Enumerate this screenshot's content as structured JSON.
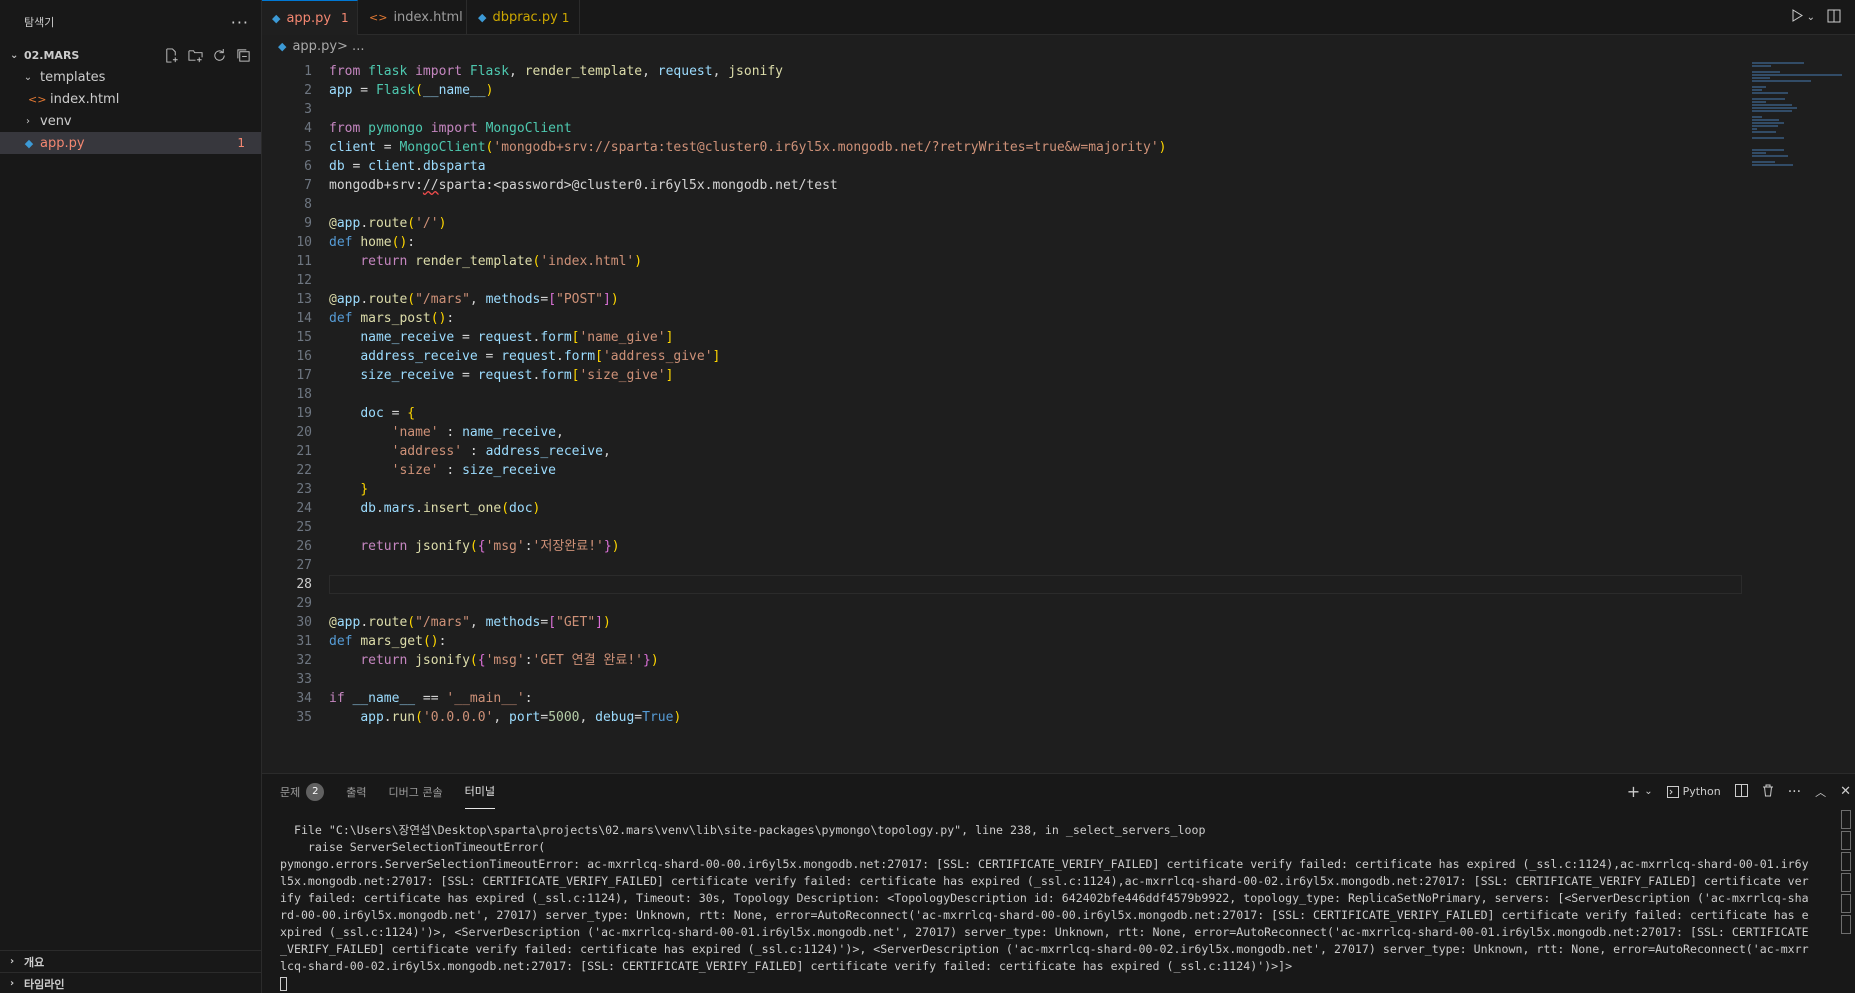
{
  "explorer": {
    "title": "탐색기",
    "more": "···",
    "root": "02.MARS",
    "items": [
      {
        "label": "templates",
        "chev": "⌄"
      },
      {
        "label": "index.html",
        "icon": "<>"
      },
      {
        "label": "venv",
        "chev": "›"
      },
      {
        "label": "app.py",
        "count": "1"
      }
    ],
    "outline": "개요",
    "timeline": "타임라인"
  },
  "tabs": [
    {
      "label": "app.py",
      "count": "1"
    },
    {
      "label": "index.html"
    },
    {
      "label": "dbprac.py",
      "count": "1"
    }
  ],
  "breadcrumb": {
    "file": "app.py",
    "rest": " > ..."
  },
  "editor": {
    "current_line": 28
  },
  "panel": {
    "tabs": [
      "문제",
      "출력",
      "디버그 콘솔",
      "터미널"
    ],
    "problems_count": "2",
    "shell": "Python",
    "terminal_text": "  File \"C:\\Users\\장연섭\\Desktop\\sparta\\projects\\02.mars\\venv\\lib\\site-packages\\pymongo\\topology.py\", line 238, in _select_servers_loop\n    raise ServerSelectionTimeoutError(\npymongo.errors.ServerSelectionTimeoutError: ac-mxrrlcq-shard-00-00.ir6yl5x.mongodb.net:27017: [SSL: CERTIFICATE_VERIFY_FAILED] certificate verify failed: certificate has expired (_ssl.c:1124),ac-mxrrlcq-shard-00-01.ir6yl5x.mongodb.net:27017: [SSL: CERTIFICATE_VERIFY_FAILED] certificate verify failed: certificate has expired (_ssl.c:1124),ac-mxrrlcq-shard-00-02.ir6yl5x.mongodb.net:27017: [SSL: CERTIFICATE_VERIFY_FAILED] certificate verify failed: certificate has expired (_ssl.c:1124), Timeout: 30s, Topology Description: <TopologyDescription id: 642402bfe446ddf4579b9922, topology_type: ReplicaSetNoPrimary, servers: [<ServerDescription ('ac-mxrrlcq-shard-00-00.ir6yl5x.mongodb.net', 27017) server_type: Unknown, rtt: None, error=AutoReconnect('ac-mxrrlcq-shard-00-00.ir6yl5x.mongodb.net:27017: [SSL: CERTIFICATE_VERIFY_FAILED] certificate verify failed: certificate has expired (_ssl.c:1124)')>, <ServerDescription ('ac-mxrrlcq-shard-00-01.ir6yl5x.mongodb.net', 27017) server_type: Unknown, rtt: None, error=AutoReconnect('ac-mxrrlcq-shard-00-01.ir6yl5x.mongodb.net:27017: [SSL: CERTIFICATE_VERIFY_FAILED] certificate verify failed: certificate has expired (_ssl.c:1124)')>, <ServerDescription ('ac-mxrrlcq-shard-00-02.ir6yl5x.mongodb.net', 27017) server_type: Unknown, rtt: None, error=AutoReconnect('ac-mxrrlcq-shard-00-02.ir6yl5x.mongodb.net:27017: [SSL: CERTIFICATE_VERIFY_FAILED] certificate verify failed: certificate has expired (_ssl.c:1124)')>]>"
  },
  "code": [
    [
      [
        "kw2",
        "from"
      ],
      [
        "plain",
        " "
      ],
      [
        "cls",
        "flask"
      ],
      [
        "plain",
        " "
      ],
      [
        "kw2",
        "import"
      ],
      [
        "plain",
        " "
      ],
      [
        "cls",
        "Flask"
      ],
      [
        "plain",
        ", "
      ],
      [
        "fn",
        "render_template"
      ],
      [
        "plain",
        ", "
      ],
      [
        "var",
        "request"
      ],
      [
        "plain",
        ", "
      ],
      [
        "fn",
        "jsonify"
      ]
    ],
    [
      [
        "var",
        "app"
      ],
      [
        "plain",
        " = "
      ],
      [
        "cls",
        "Flask"
      ],
      [
        "br1",
        "("
      ],
      [
        "var",
        "__name__"
      ],
      [
        "br1",
        ")"
      ]
    ],
    [],
    [
      [
        "kw2",
        "from"
      ],
      [
        "plain",
        " "
      ],
      [
        "cls",
        "pymongo"
      ],
      [
        "plain",
        " "
      ],
      [
        "kw2",
        "import"
      ],
      [
        "plain",
        " "
      ],
      [
        "cls",
        "MongoClient"
      ]
    ],
    [
      [
        "var",
        "client"
      ],
      [
        "plain",
        " = "
      ],
      [
        "cls",
        "MongoClient"
      ],
      [
        "br1",
        "("
      ],
      [
        "str",
        "'mongodb+srv://sparta:test@cluster0.ir6yl5x.mongodb.net/?retryWrites=true&w=majority'"
      ],
      [
        "br1",
        ")"
      ]
    ],
    [
      [
        "var",
        "db"
      ],
      [
        "plain",
        " = "
      ],
      [
        "var",
        "client"
      ],
      [
        "plain",
        "."
      ],
      [
        "var",
        "dbsparta"
      ]
    ],
    [
      [
        "plain",
        "mongodb+srv:"
      ],
      [
        "squig",
        "//"
      ],
      [
        "plain",
        "sparta:<password>@cluster0.ir6yl5x.mongodb.net/test"
      ]
    ],
    [],
    [
      [
        "dec",
        "@"
      ],
      [
        "var",
        "app"
      ],
      [
        "plain",
        "."
      ],
      [
        "fn",
        "route"
      ],
      [
        "br1",
        "("
      ],
      [
        "str",
        "'/'"
      ],
      [
        "br1",
        ")"
      ]
    ],
    [
      [
        "kw",
        "def"
      ],
      [
        "plain",
        " "
      ],
      [
        "fn",
        "home"
      ],
      [
        "br1",
        "()"
      ],
      [
        "plain",
        ":"
      ]
    ],
    [
      [
        "plain",
        "    "
      ],
      [
        "kw2",
        "return"
      ],
      [
        "plain",
        " "
      ],
      [
        "fn",
        "render_template"
      ],
      [
        "br1",
        "("
      ],
      [
        "str",
        "'index.html'"
      ],
      [
        "br1",
        ")"
      ]
    ],
    [],
    [
      [
        "dec",
        "@"
      ],
      [
        "var",
        "app"
      ],
      [
        "plain",
        "."
      ],
      [
        "fn",
        "route"
      ],
      [
        "br1",
        "("
      ],
      [
        "str",
        "\"/mars\""
      ],
      [
        "plain",
        ", "
      ],
      [
        "var",
        "methods"
      ],
      [
        "plain",
        "="
      ],
      [
        "br2",
        "["
      ],
      [
        "str",
        "\"POST\""
      ],
      [
        "br2",
        "]"
      ],
      [
        "br1",
        ")"
      ]
    ],
    [
      [
        "kw",
        "def"
      ],
      [
        "plain",
        " "
      ],
      [
        "fn",
        "mars_post"
      ],
      [
        "br1",
        "()"
      ],
      [
        "plain",
        ":"
      ]
    ],
    [
      [
        "plain",
        "    "
      ],
      [
        "var",
        "name_receive"
      ],
      [
        "plain",
        " = "
      ],
      [
        "var",
        "request"
      ],
      [
        "plain",
        "."
      ],
      [
        "var",
        "form"
      ],
      [
        "br1",
        "["
      ],
      [
        "str",
        "'name_give'"
      ],
      [
        "br1",
        "]"
      ]
    ],
    [
      [
        "plain",
        "    "
      ],
      [
        "var",
        "address_receive"
      ],
      [
        "plain",
        " = "
      ],
      [
        "var",
        "request"
      ],
      [
        "plain",
        "."
      ],
      [
        "var",
        "form"
      ],
      [
        "br1",
        "["
      ],
      [
        "str",
        "'address_give'"
      ],
      [
        "br1",
        "]"
      ]
    ],
    [
      [
        "plain",
        "    "
      ],
      [
        "var",
        "size_receive"
      ],
      [
        "plain",
        " = "
      ],
      [
        "var",
        "request"
      ],
      [
        "plain",
        "."
      ],
      [
        "var",
        "form"
      ],
      [
        "br1",
        "["
      ],
      [
        "str",
        "'size_give'"
      ],
      [
        "br1",
        "]"
      ]
    ],
    [],
    [
      [
        "plain",
        "    "
      ],
      [
        "var",
        "doc"
      ],
      [
        "plain",
        " = "
      ],
      [
        "br1",
        "{"
      ]
    ],
    [
      [
        "plain",
        "        "
      ],
      [
        "str",
        "'name'"
      ],
      [
        "plain",
        " : "
      ],
      [
        "var",
        "name_receive"
      ],
      [
        "plain",
        ","
      ]
    ],
    [
      [
        "plain",
        "        "
      ],
      [
        "str",
        "'address'"
      ],
      [
        "plain",
        " : "
      ],
      [
        "var",
        "address_receive"
      ],
      [
        "plain",
        ","
      ]
    ],
    [
      [
        "plain",
        "        "
      ],
      [
        "str",
        "'size'"
      ],
      [
        "plain",
        " : "
      ],
      [
        "var",
        "size_receive"
      ]
    ],
    [
      [
        "plain",
        "    "
      ],
      [
        "br1",
        "}"
      ]
    ],
    [
      [
        "plain",
        "    "
      ],
      [
        "var",
        "db"
      ],
      [
        "plain",
        "."
      ],
      [
        "var",
        "mars"
      ],
      [
        "plain",
        "."
      ],
      [
        "fn",
        "insert_one"
      ],
      [
        "br1",
        "("
      ],
      [
        "var",
        "doc"
      ],
      [
        "br1",
        ")"
      ]
    ],
    [],
    [
      [
        "plain",
        "    "
      ],
      [
        "kw2",
        "return"
      ],
      [
        "plain",
        " "
      ],
      [
        "fn",
        "jsonify"
      ],
      [
        "br1",
        "("
      ],
      [
        "br2",
        "{"
      ],
      [
        "str",
        "'msg'"
      ],
      [
        "plain",
        ":"
      ],
      [
        "str",
        "'저장완료!'"
      ],
      [
        "br2",
        "}"
      ],
      [
        "br1",
        ")"
      ]
    ],
    [],
    [],
    [],
    [
      [
        "dec",
        "@"
      ],
      [
        "var",
        "app"
      ],
      [
        "plain",
        "."
      ],
      [
        "fn",
        "route"
      ],
      [
        "br1",
        "("
      ],
      [
        "str",
        "\"/mars\""
      ],
      [
        "plain",
        ", "
      ],
      [
        "var",
        "methods"
      ],
      [
        "plain",
        "="
      ],
      [
        "br2",
        "["
      ],
      [
        "str",
        "\"GET\""
      ],
      [
        "br2",
        "]"
      ],
      [
        "br1",
        ")"
      ]
    ],
    [
      [
        "kw",
        "def"
      ],
      [
        "plain",
        " "
      ],
      [
        "fn",
        "mars_get"
      ],
      [
        "br1",
        "()"
      ],
      [
        "plain",
        ":"
      ]
    ],
    [
      [
        "plain",
        "    "
      ],
      [
        "kw2",
        "return"
      ],
      [
        "plain",
        " "
      ],
      [
        "fn",
        "jsonify"
      ],
      [
        "br1",
        "("
      ],
      [
        "br2",
        "{"
      ],
      [
        "str",
        "'msg'"
      ],
      [
        "plain",
        ":"
      ],
      [
        "str",
        "'GET 연결 완료!'"
      ],
      [
        "br2",
        "}"
      ],
      [
        "br1",
        ")"
      ]
    ],
    [],
    [
      [
        "kw2",
        "if"
      ],
      [
        "plain",
        " "
      ],
      [
        "var",
        "__name__"
      ],
      [
        "plain",
        " == "
      ],
      [
        "str",
        "'__main__'"
      ],
      [
        "plain",
        ":"
      ]
    ],
    [
      [
        "plain",
        "    "
      ],
      [
        "var",
        "app"
      ],
      [
        "plain",
        "."
      ],
      [
        "fn",
        "run"
      ],
      [
        "br1",
        "("
      ],
      [
        "str",
        "'0.0.0.0'"
      ],
      [
        "plain",
        ", "
      ],
      [
        "var",
        "port"
      ],
      [
        "plain",
        "="
      ],
      [
        "num",
        "5000"
      ],
      [
        "plain",
        ", "
      ],
      [
        "var",
        "debug"
      ],
      [
        "plain",
        "="
      ],
      [
        "kw",
        "True"
      ],
      [
        "br1",
        ")"
      ]
    ]
  ]
}
